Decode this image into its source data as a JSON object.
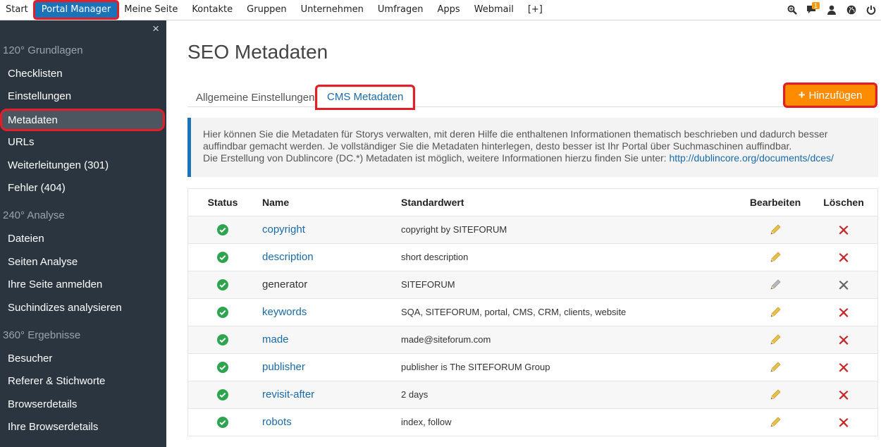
{
  "topnav": {
    "items": [
      "Start",
      "Portal Manager",
      "Meine Seite",
      "Kontakte",
      "Gruppen",
      "Unternehmen",
      "Umfragen",
      "Apps",
      "Webmail",
      "[+]"
    ],
    "active_index": 1,
    "notification_count": "1",
    "icons": [
      "search-icon",
      "chat-icon",
      "user-icon",
      "globe-icon",
      "power-icon"
    ]
  },
  "sidebar": {
    "close_label": "×",
    "sections": [
      {
        "title": "120° Grundlagen",
        "items": [
          "Checklisten",
          "Einstellungen",
          "Metadaten",
          "URLs",
          "Weiterleitungen (301)",
          "Fehler (404)"
        ]
      },
      {
        "title": "240° Analyse",
        "items": [
          "Dateien",
          "Seiten Analyse",
          "Ihre Seite anmelden",
          "Suchindizes analysieren"
        ]
      },
      {
        "title": "360° Ergebnisse",
        "items": [
          "Besucher",
          "Referer & Stichworte",
          "Browserdetails",
          "Ihre Browserdetails"
        ]
      }
    ],
    "active_item": "Metadaten"
  },
  "main": {
    "title": "SEO Metadaten",
    "tabs": [
      "Allgemeine Einstellungen",
      "CMS Metadaten"
    ],
    "active_tab": 1,
    "add_button_label": "Hinzufügen",
    "info": {
      "line1": "Hier können Sie die Metadaten für Storys verwalten, mit deren Hilfe die enthaltenen Informationen thematisch beschrieben und dadurch besser auffindbar gemacht werden. Je vollständiger Sie die Metadaten hinterlegen, desto besser ist Ihr Portal über Suchmaschinen auffindbar.",
      "line2": "Die Erstellung von Dublincore (DC.*) Metadaten ist möglich, weitere Informationen hierzu finden Sie unter:",
      "link": "http://dublincore.org/documents/dces/"
    },
    "table": {
      "headers": {
        "status": "Status",
        "name": "Name",
        "default": "Standardwert",
        "edit": "Bearbeiten",
        "delete": "Löschen"
      },
      "rows": [
        {
          "name": "copyright",
          "value": "copyright by SITEFORUM",
          "editable": true
        },
        {
          "name": "description",
          "value": "short description",
          "editable": true
        },
        {
          "name": "generator",
          "value": "SITEFORUM",
          "editable": false
        },
        {
          "name": "keywords",
          "value": "SQA, SITEFORUM, portal, CMS, CRM, clients, website",
          "editable": true
        },
        {
          "name": "made",
          "value": "made@siteforum.com",
          "editable": true
        },
        {
          "name": "publisher",
          "value": "publisher is The SITEFORUM Group",
          "editable": true
        },
        {
          "name": "revisit-after",
          "value": "2 days",
          "editable": true
        },
        {
          "name": "robots",
          "value": "index, follow",
          "editable": true
        }
      ]
    }
  },
  "colors": {
    "accent": "#1a73b8",
    "highlight": "#e41e26",
    "add_button": "#ff8c00",
    "status_ok": "#2ea44f",
    "sidebar_bg": "#2b3540"
  }
}
